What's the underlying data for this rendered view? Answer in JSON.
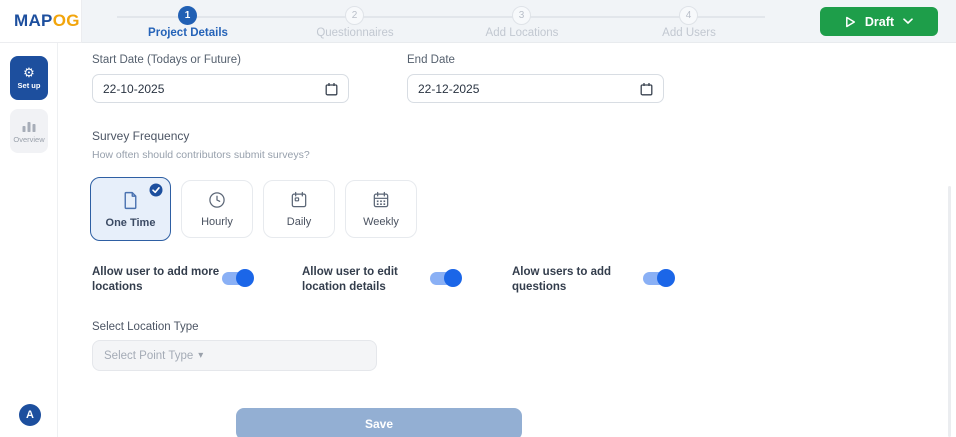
{
  "colors": {
    "primary_blue": "#1d4f9e",
    "step_active_blue": "#2160b4",
    "accent_blue": "#1b66e8",
    "toggle_track_blue": "#8ab0f5",
    "draft_green": "#1e9e4a",
    "header_band": "#f1f4f7",
    "save_button_blue": "#93afd3",
    "logo_orange": "#f2a50c",
    "selected_card_bg": "#e7effa",
    "selected_card_border": "#2e5fa3"
  },
  "logo": {
    "text_blue": "MAP",
    "text_orange": "OG"
  },
  "header": {
    "draft_label": "Draft",
    "steps": [
      {
        "number": "1",
        "label": "Project Details",
        "state": "active"
      },
      {
        "number": "2",
        "label": "Questionnaires",
        "state": "upcoming"
      },
      {
        "number": "3",
        "label": "Add Locations",
        "state": "upcoming"
      },
      {
        "number": "4",
        "label": "Add Users",
        "state": "upcoming"
      }
    ]
  },
  "sidebar": {
    "items": [
      {
        "label": "Set up",
        "active": true
      },
      {
        "label": "Overview",
        "active": false
      }
    ],
    "avatar_initial": "A"
  },
  "form": {
    "start_date": {
      "label": "Start Date (Todays or Future)",
      "value": "22-10-2025"
    },
    "end_date": {
      "label": "End Date",
      "value": "22-12-2025"
    },
    "frequency": {
      "label": "Survey Frequency",
      "hint": "How often should contributors submit surveys?",
      "options": [
        {
          "label": "One Time",
          "selected": true
        },
        {
          "label": "Hourly",
          "selected": false
        },
        {
          "label": "Daily",
          "selected": false
        },
        {
          "label": "Weekly",
          "selected": false
        }
      ]
    },
    "toggles": [
      {
        "label": "Allow user to add more locations",
        "on": true
      },
      {
        "label": "Allow user to edit location details",
        "on": true
      },
      {
        "label": "Alow users to add questions",
        "on": true
      }
    ],
    "location_type": {
      "label": "Select Location Type",
      "placeholder": "Select Point Type"
    },
    "save_label": "Save"
  },
  "icons": {
    "caret_down": "▾",
    "gear": "⚙"
  }
}
